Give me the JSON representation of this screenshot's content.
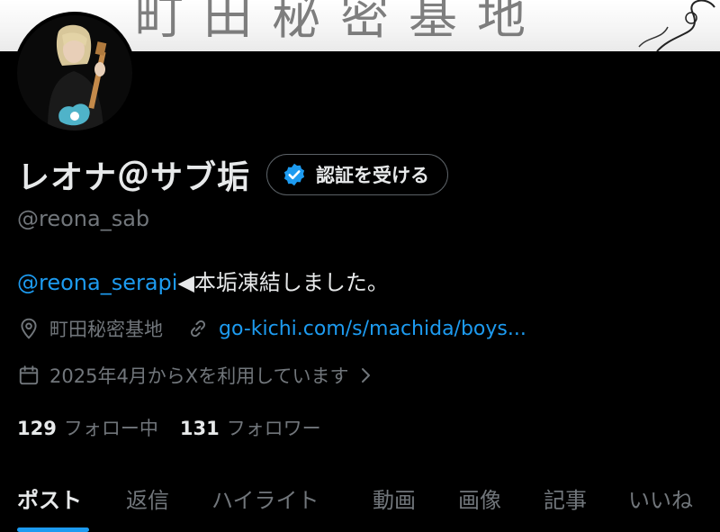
{
  "banner": {
    "kanji": "町田秘密基地"
  },
  "profile": {
    "name": "レオナ＠サブ垢",
    "verify_button": "認証を受ける",
    "handle": "@reona_sab",
    "bio_mention": "@reona_serapi",
    "bio_text": "◀本垢凍結しました。",
    "location": "町田秘密基地",
    "link": "go-kichi.com/s/machida/boys...",
    "joined": "2025年4月からXを利用しています",
    "following_count": "129",
    "following_label": "フォロー中",
    "followers_count": "131",
    "followers_label": "フォロワー"
  },
  "tabs": [
    "ポスト",
    "返信",
    "ハイライト",
    "動画",
    "画像",
    "記事",
    "いいね"
  ],
  "colors": {
    "background": "#000000",
    "text": "#e7e9ea",
    "muted": "#71767b",
    "accent": "#1d9bf0"
  },
  "icons": {
    "verified": "verified-badge-icon",
    "location": "location-pin-icon",
    "link": "link-icon",
    "calendar": "calendar-icon",
    "chevron": "chevron-right-icon"
  }
}
